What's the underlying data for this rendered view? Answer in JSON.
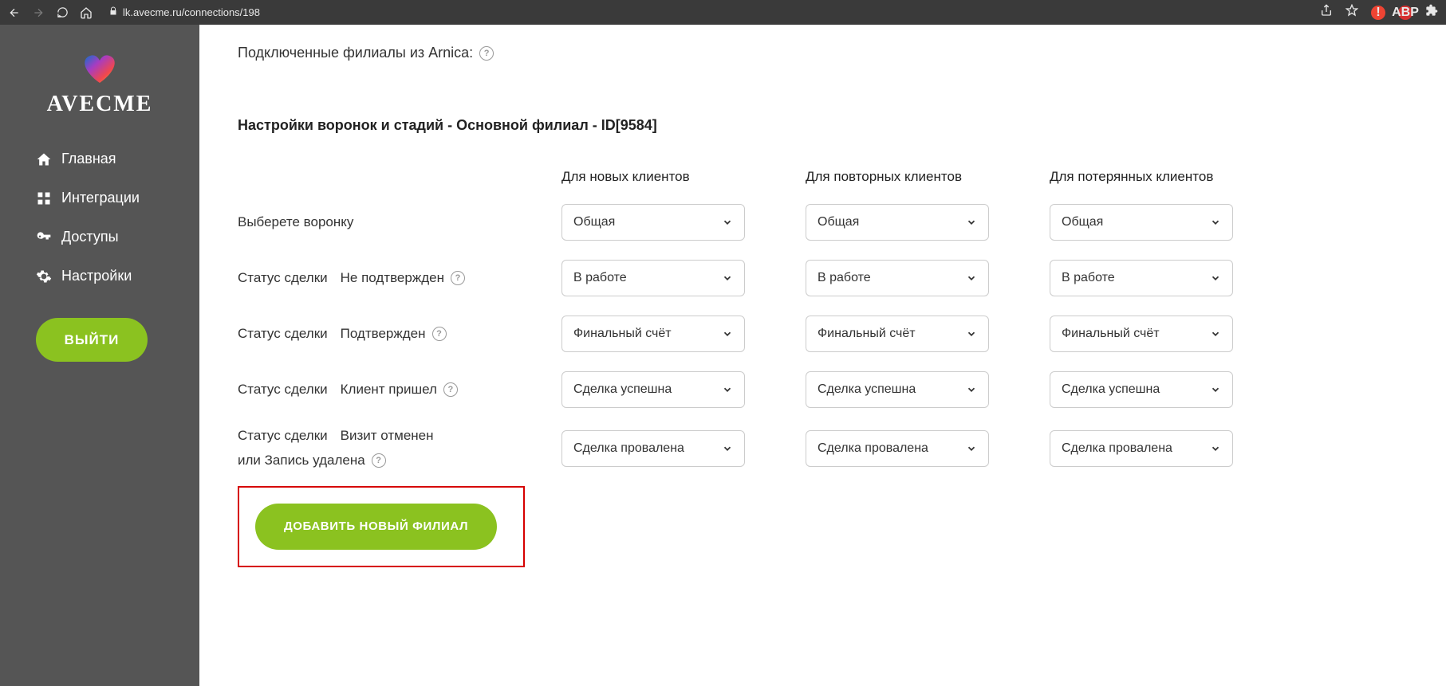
{
  "browser": {
    "url": "lk.avecme.ru/connections/198"
  },
  "brand": "AVECME",
  "sidebar": {
    "items": [
      {
        "label": "Главная"
      },
      {
        "label": "Интеграции"
      },
      {
        "label": "Доступы"
      },
      {
        "label": "Настройки"
      }
    ],
    "logout_label": "ВЫЙТИ"
  },
  "main": {
    "connected_branches_label": "Подключенные филиалы из Arnica:",
    "funnel_title": "Настройки воронок и стадий - Основной филиал - ID[9584]",
    "columns": [
      "Для новых клиентов",
      "Для повторных клиентов",
      "Для потерянных клиентов"
    ],
    "rows": [
      {
        "label": "Выберете воронку",
        "help": false,
        "values": [
          "Общая",
          "Общая",
          "Общая"
        ]
      },
      {
        "label": "Статус сделки\nНе подтвержден",
        "help": true,
        "values": [
          "В работе",
          "В работе",
          "В работе"
        ]
      },
      {
        "label": "Статус сделки\nПодтвержден",
        "help": true,
        "values": [
          "Финальный счёт",
          "Финальный счёт",
          "Финальный счёт"
        ]
      },
      {
        "label": "Статус сделки\nКлиент пришел",
        "help": true,
        "values": [
          "Сделка успешна",
          "Сделка успешна",
          "Сделка успешна"
        ]
      },
      {
        "label": "Статус сделки\nВизит отменен\nили Запись удалена",
        "help": true,
        "values": [
          "Сделка провалена",
          "Сделка провалена",
          "Сделка провалена"
        ]
      }
    ],
    "add_branch_label": "ДОБАВИТЬ НОВЫЙ ФИЛИАЛ"
  }
}
